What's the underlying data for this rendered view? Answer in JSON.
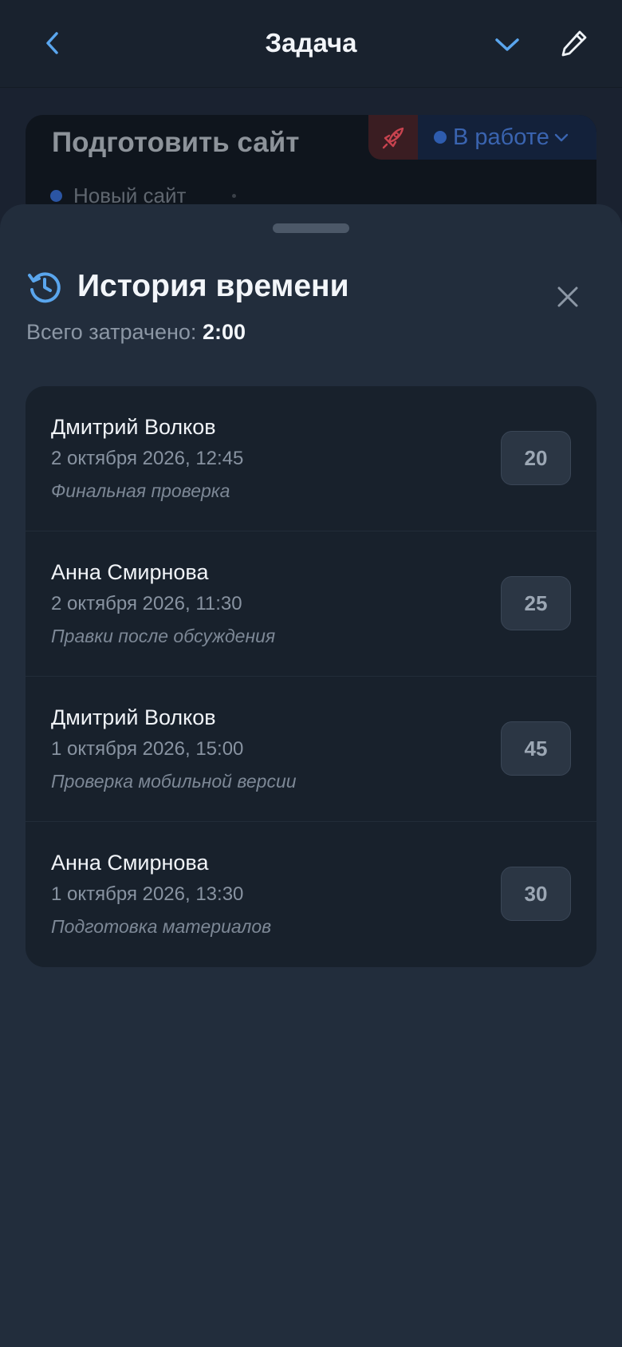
{
  "header": {
    "title": "Задача",
    "back_icon": "chevron-left-icon",
    "collapse_icon": "chevron-down-icon",
    "edit_icon": "pencil-icon"
  },
  "task": {
    "title": "Подготовить сайт",
    "priority_icon": "rocket-icon",
    "status": "В работе",
    "project": "Новый сайт"
  },
  "sheet": {
    "title": "История времени",
    "total_label": "Всего затрачено:",
    "total_value": "2:00",
    "entries": [
      {
        "name": "Дмитрий Волков",
        "date": "2 октября 2026, 12:45",
        "note": "Финальная проверка",
        "minutes": "20"
      },
      {
        "name": "Анна Смирнова",
        "date": "2 октября 2026, 11:30",
        "note": "Правки после обсуждения",
        "minutes": "25"
      },
      {
        "name": "Дмитрий Волков",
        "date": "1 октября 2026, 15:00",
        "note": "Проверка мобильной версии",
        "minutes": "45"
      },
      {
        "name": "Анна Смирнова",
        "date": "1 октября 2026, 13:30",
        "note": "Подготовка материалов",
        "minutes": "30"
      }
    ]
  },
  "colors": {
    "accent": "#5aa6ee",
    "status_blue": "#3a64b0",
    "priority_red": "#c8434f",
    "sheet_bg": "#222d3c",
    "list_bg": "#18212c"
  }
}
